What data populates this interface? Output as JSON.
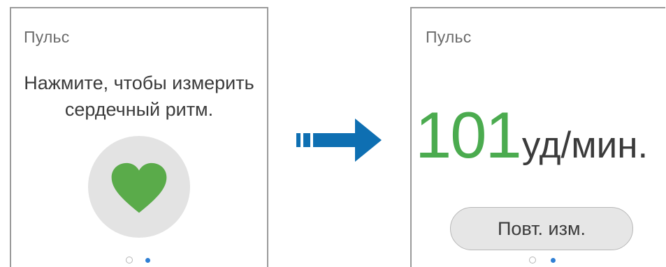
{
  "screen_before": {
    "title": "Пульс",
    "prompt_line1": "Нажмите, чтобы измерить",
    "prompt_line2": "сердечный ритм.",
    "heart_button_icon": "heart-icon",
    "page_indicator": {
      "pages": 2,
      "current": 2
    }
  },
  "transition": {
    "icon": "arrow-right-icon",
    "color": "#0e6fb2"
  },
  "screen_after": {
    "title": "Пульс",
    "bpm_value": "101",
    "bpm_unit": "уд/мин.",
    "remeasure_label": "Повт. изм.",
    "page_indicator": {
      "pages": 2,
      "current": 2
    }
  },
  "colors": {
    "heart": "#5aab4a",
    "bpm_value": "#4bab4f",
    "active_dot": "#2f7fd4"
  }
}
